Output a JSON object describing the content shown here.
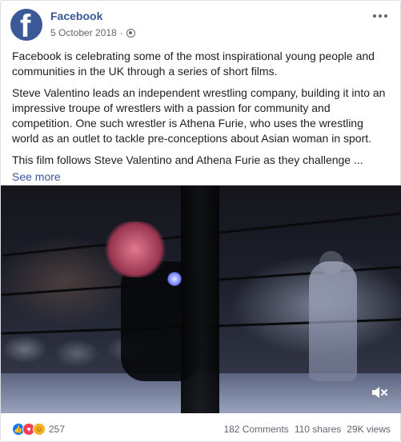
{
  "post": {
    "page_name": "Facebook",
    "date": "5 October 2018",
    "dot_separator": "·",
    "paragraphs": [
      "Facebook is celebrating some of the most inspirational young people and communities in the UK through a series of short films.",
      "Steve Valentino leads an independent wrestling company, building it into an impressive troupe of wrestlers with a passion for community and competition. One such wrestler is Athena Furie, who uses the wrestling world as an outlet to tackle pre-conceptions about Asian woman in sport.",
      "This film follows Steve Valentino and Athena Furie as they challenge ..."
    ],
    "see_more": "See more"
  },
  "footer": {
    "reaction_count": "257",
    "comments": "182 Comments",
    "shares": "110 shares",
    "views": "29K views"
  },
  "icons": {
    "avatar": "facebook-logo",
    "privacy": "globe-icon",
    "menu": "more-icon",
    "mute": "speaker-mute-icon",
    "reactions": [
      "like-icon",
      "love-icon",
      "haha-icon"
    ]
  },
  "colors": {
    "brand": "#3b5998",
    "link": "#385898",
    "like": "#1877f2",
    "love": "#f33e58",
    "haha": "#f7b125"
  }
}
